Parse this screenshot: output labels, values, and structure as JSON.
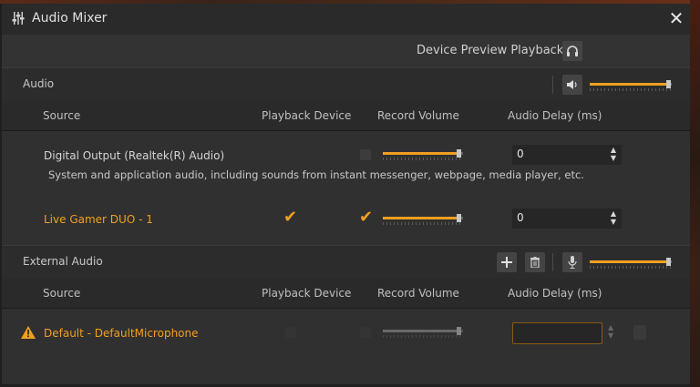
{
  "window": {
    "title": "Audio Mixer",
    "close_glyph": "✕"
  },
  "preview": {
    "label": "Device Preview Playback",
    "icon": "headphones-icon"
  },
  "audio_section": {
    "label": "Audio",
    "icon": "speaker-icon",
    "master_volume_fraction": 0.97,
    "columns": [
      "Source",
      "Playback Device",
      "Record Volume",
      "Audio Delay (ms)"
    ],
    "rows": [
      {
        "name": "Digital Output (Realtek(R) Audio)",
        "description": "System and application audio, including sounds from instant messenger, webpage, media player, etc.",
        "playback_checked": false,
        "record_checked": false,
        "record_volume_fraction": 0.96,
        "delay": "0"
      },
      {
        "name": "Live Gamer DUO - 1",
        "playback_checked": true,
        "record_checked": true,
        "record_volume_fraction": 0.96,
        "delay": "0"
      }
    ]
  },
  "external_section": {
    "label": "External Audio",
    "add_icon": "plus-icon",
    "delete_icon": "trash-icon",
    "mic_icon": "microphone-icon",
    "master_volume_fraction": 0.97,
    "columns": [
      "Source",
      "Playback Device",
      "Record Volume",
      "Audio Delay (ms)"
    ],
    "rows": [
      {
        "name": "Default - DefaultMicrophone",
        "warning_icon": "warning-icon",
        "playback_checked": false,
        "record_checked": false,
        "record_volume_fraction": 0.96,
        "delay": ""
      }
    ]
  },
  "colors": {
    "accent": "#f0a020",
    "background": "#303030",
    "text": "#c8c8c8"
  }
}
